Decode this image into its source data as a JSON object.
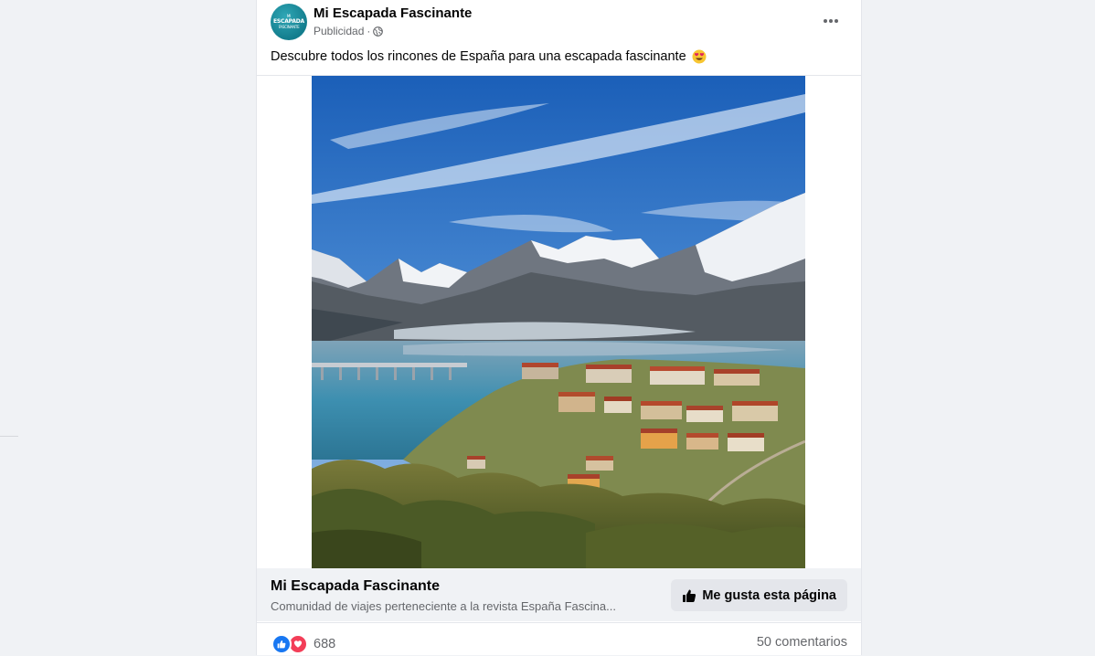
{
  "post": {
    "page_name": "Mi Escapada Fascinante",
    "avatar_text": [
      "MI",
      "ESCAPADA",
      "FASCINANTE"
    ],
    "sponsored_label": "Publicidad",
    "separator": "·",
    "audience_icon": "globe-icon",
    "menu_icon": "more-options-icon",
    "caption": "Descubre todos los rincones de España para una escapada fascinante",
    "caption_emoji": "heart-eyes-emoji"
  },
  "cta": {
    "title": "Mi Escapada Fascinante",
    "subtitle": "Comunidad de viajes perteneciente a la revista España Fascina...",
    "button_label": "Me gusta esta página",
    "button_icon": "thumbs-up-icon"
  },
  "footer": {
    "reactions": [
      "like-icon",
      "love-icon"
    ],
    "reaction_count": "688",
    "comments": "50 comentarios"
  },
  "colors": {
    "brand_teal": "#1a8b9b",
    "like_blue": "#1877f2",
    "love_red": "#f33e58",
    "page_bg": "#f0f2f5"
  }
}
